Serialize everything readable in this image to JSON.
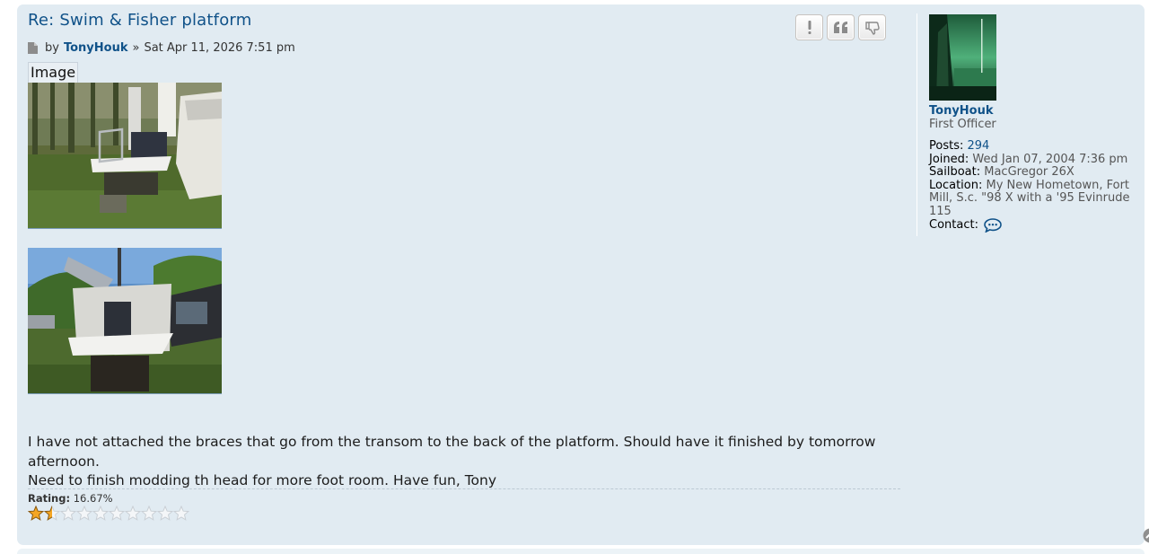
{
  "post": {
    "title": "Re: Swim & Fisher platform",
    "by_label": "by",
    "author": "TonyHouk",
    "separator": "»",
    "date": "Sat Apr 11, 2026 7:51 pm",
    "image_label": "Image",
    "text_lines": [
      "I have not attached the braces that go from the transom to the back of the platform. Should have it finished by tomorrow afternoon.",
      "Need to finish modding th head for more foot room. Have fun, Tony"
    ],
    "rating_label": "Rating:",
    "rating_value": "16.67%",
    "rating_fraction": 0.1667,
    "stars_total": 10,
    "stars_filled": 1.5,
    "buttons": [
      "report-icon",
      "quote-icon",
      "thumbs-down-icon"
    ]
  },
  "profile": {
    "username": "TonyHouk",
    "rank": "First Officer",
    "posts_label": "Posts:",
    "posts_value": "294",
    "joined_label": "Joined:",
    "joined_value": "Wed Jan 07, 2004 7:36 pm",
    "sailboat_label": "Sailboat:",
    "sailboat_value": "MacGregor 26X",
    "location_label": "Location:",
    "location_value": "My New Hometown, Fort Mill, S.c. \"98 X with a '95 Evinrude 115",
    "contact_label": "Contact:",
    "contact_icon": "chat-bubble-icon"
  },
  "colors": {
    "post_bg": "#e1ebf2",
    "link": "#105289",
    "star_fill": "#f5a623"
  }
}
